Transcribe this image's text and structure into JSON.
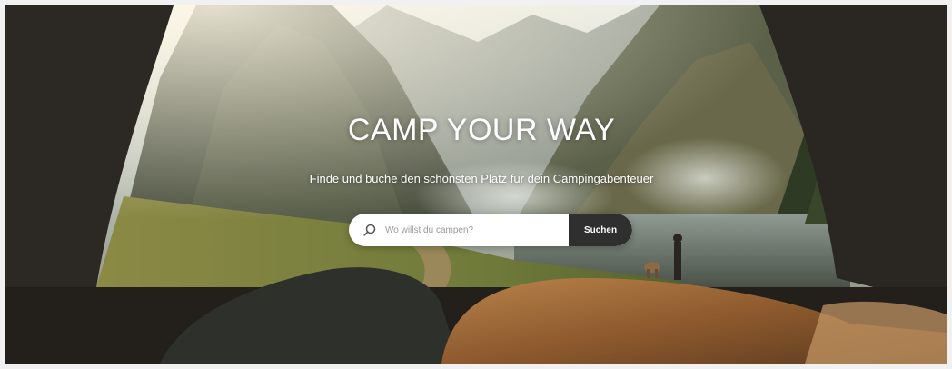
{
  "hero": {
    "title": "CAMP YOUR WAY",
    "subtitle": "Finde und buche den schönsten Platz für dein Campingabenteuer"
  },
  "search": {
    "placeholder": "Wo willst du campen?",
    "button_label": "Suchen",
    "icon": "search-icon"
  },
  "colors": {
    "page_bg": "#f1f1f1",
    "button_bg": "#2f2f2f",
    "text_light": "#ffffff"
  }
}
